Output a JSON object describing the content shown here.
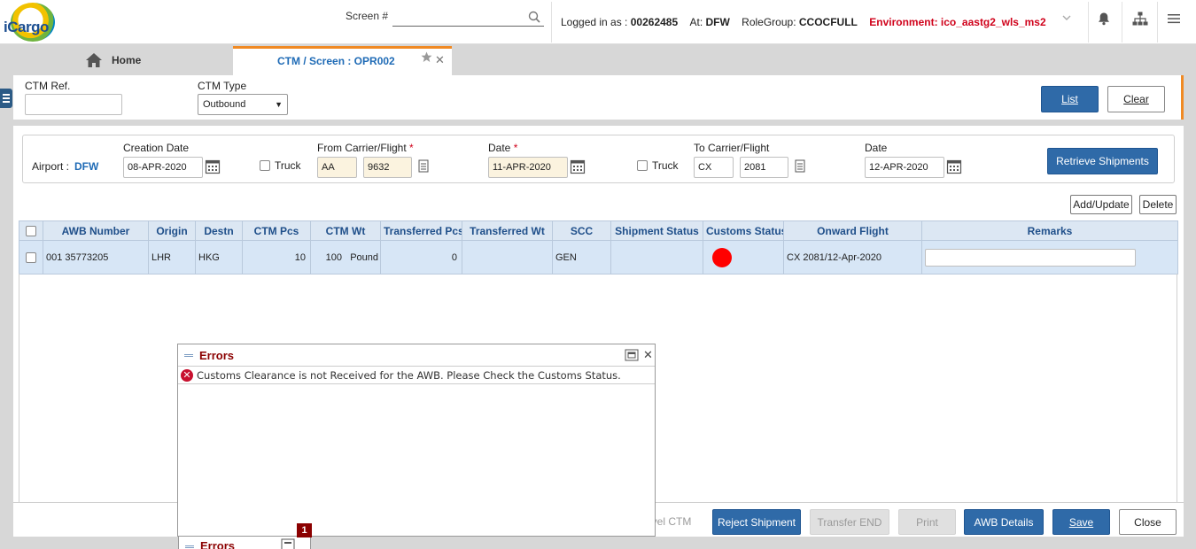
{
  "header": {
    "logo_text": "iCargo",
    "screen_label": "Screen #",
    "screen_value": "",
    "logged_in_label": "Logged in as :",
    "user": "00262485",
    "at_label": "At:",
    "station": "DFW",
    "rolegroup_label": "RoleGroup:",
    "rolegroup": "CCOCFULL",
    "environment": "Environment: ico_aastg2_wls_ms2"
  },
  "tabs": {
    "home": "Home",
    "active": "CTM / Screen : OPR002"
  },
  "form": {
    "ctm_ref_label": "CTM Ref.",
    "ctm_ref_value": "",
    "ctm_type_label": "CTM Type",
    "ctm_type_value": "Outbound",
    "list_btn": "List",
    "clear_btn": "Clear"
  },
  "filter": {
    "airport_label": "Airport :",
    "airport_value": "DFW",
    "creation_date_label": "Creation Date",
    "creation_date": "08-APR-2020",
    "truck1_label": "Truck",
    "from_label": "From Carrier/Flight",
    "from_carrier": "AA",
    "from_flight": "9632",
    "date1_label": "Date",
    "date1": "11-APR-2020",
    "truck2_label": "Truck",
    "to_label": "To Carrier/Flight",
    "to_carrier": "CX",
    "to_flight": "2081",
    "date2_label": "Date",
    "date2": "12-APR-2020",
    "retrieve_btn": "Retrieve Shipments",
    "required_mark": "*"
  },
  "grid_actions": {
    "add_update": "Add/Update",
    "delete": "Delete"
  },
  "table": {
    "headers": [
      "AWB Number",
      "Origin",
      "Destn",
      "CTM Pcs",
      "CTM Wt",
      "Transferred Pcs",
      "Transferred Wt",
      "SCC",
      "Shipment Status",
      "Customs Status",
      "Onward Flight",
      "Remarks"
    ],
    "rows": [
      {
        "awb": "001 35773205",
        "origin": "LHR",
        "destn": "HKG",
        "ctm_pcs": "10",
        "ctm_wt": "100",
        "ctm_wt_unit": "Pound",
        "transferred_pcs": "0",
        "transferred_wt": "",
        "scc": "GEN",
        "shipment_status": "",
        "customs_status_color": "#ff0000",
        "onward_flight": "CX 2081/12-Apr-2020",
        "remarks": ""
      }
    ]
  },
  "errors_popup": {
    "title": "Errors",
    "message": "Customs Clearance is not Received for the AWB. Please Check the Customs Status.",
    "minimized_title": "Errors",
    "count": "1"
  },
  "footer": {
    "level_ctm": "evel CTM",
    "reject_shipment": "Reject Shipment",
    "transfer_end": "Transfer END",
    "print": "Print",
    "awb_details": "AWB Details",
    "save": "Save",
    "close": "Close"
  },
  "colors": {
    "primary": "#2f6aa8",
    "accent": "#f08a24",
    "error": "#8b0000",
    "env": "#d0021b"
  }
}
